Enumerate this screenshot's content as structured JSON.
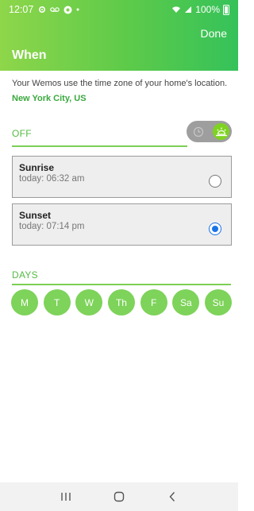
{
  "status": {
    "time": "12:07",
    "battery": "100%"
  },
  "header": {
    "done_label": "Done",
    "title": "When"
  },
  "info": {
    "description": "Your Wemos use the time zone of your home's location.",
    "location": "New York City, US"
  },
  "mode": {
    "label": "OFF",
    "toggle_selected": "sun"
  },
  "options": [
    {
      "label": "Sunrise",
      "time": "today: 06:32 am",
      "selected": false
    },
    {
      "label": "Sunset",
      "time": "today: 07:14 pm",
      "selected": true
    }
  ],
  "days": {
    "label": "DAYS",
    "items": [
      "M",
      "T",
      "W",
      "Th",
      "F",
      "Sa",
      "Su"
    ]
  },
  "colors": {
    "accent_green": "#5cca4a",
    "day_green": "#7ed35a",
    "radio_blue": "#1a73e8"
  },
  "icons": {
    "toggle_left": "clock-icon",
    "toggle_right": "sun-icon"
  }
}
